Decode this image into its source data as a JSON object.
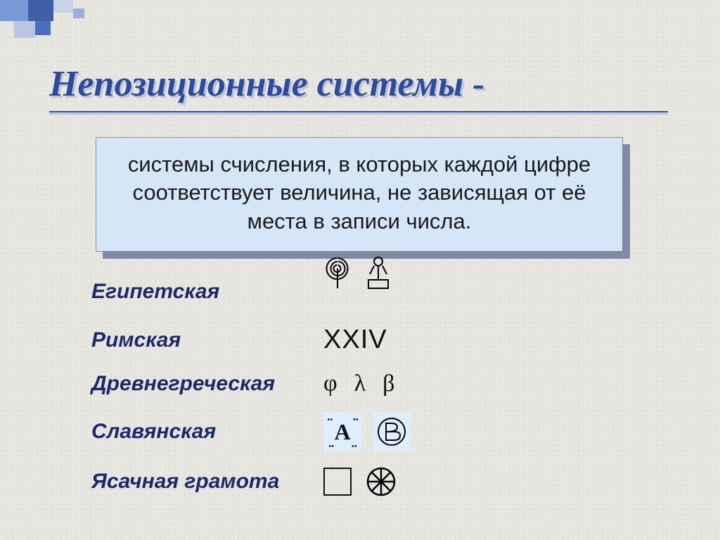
{
  "title": "Непозиционные системы -",
  "definition": "системы счисления, в которых каждой цифре соответствует величина, не зависящая от её места в записи числа.",
  "systems": {
    "egyptian": {
      "label": "Египетская"
    },
    "roman": {
      "label": "Римская",
      "symbol": "XXIV"
    },
    "greek": {
      "label": "Древнегреческая",
      "symbols": [
        "φ",
        "λ",
        "β"
      ]
    },
    "slavic": {
      "label": "Славянская"
    },
    "yasak": {
      "label": "Ясачная грамота"
    }
  }
}
